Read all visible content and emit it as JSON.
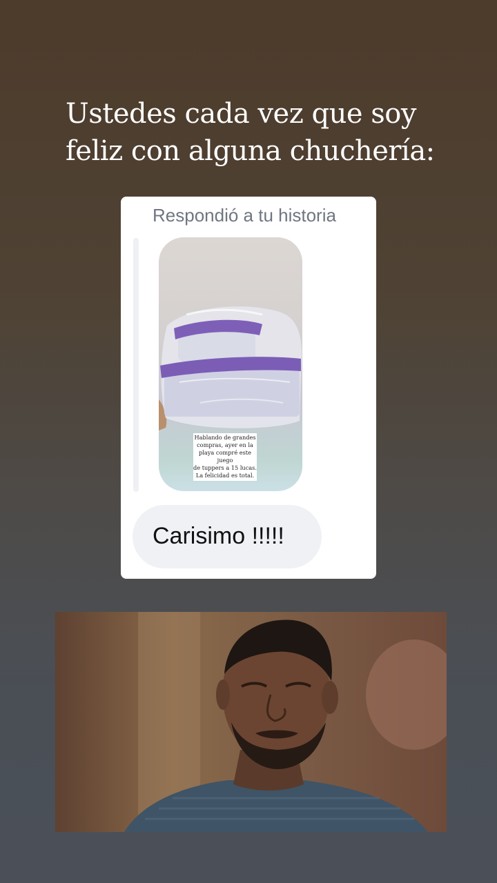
{
  "story": {
    "text_lines": [
      "Ustedes cada vez que soy",
      "feliz con alguna chuchería:"
    ]
  },
  "reply_card": {
    "header": "Respondió a tu historia",
    "story_caption_lines": [
      "Hablando de grandes",
      "compras, ayer en la",
      "playa compré este juego",
      "de tuppers a 15 lucas.",
      "La felicidad es total."
    ],
    "message": "Carisimo !!!!!"
  },
  "colors": {
    "background_top": "#4d3b2b",
    "background_bottom": "#4b5058",
    "card": "#ffffff",
    "bubble": "#eff1f5",
    "lid_purple": "#7e5fb8"
  }
}
